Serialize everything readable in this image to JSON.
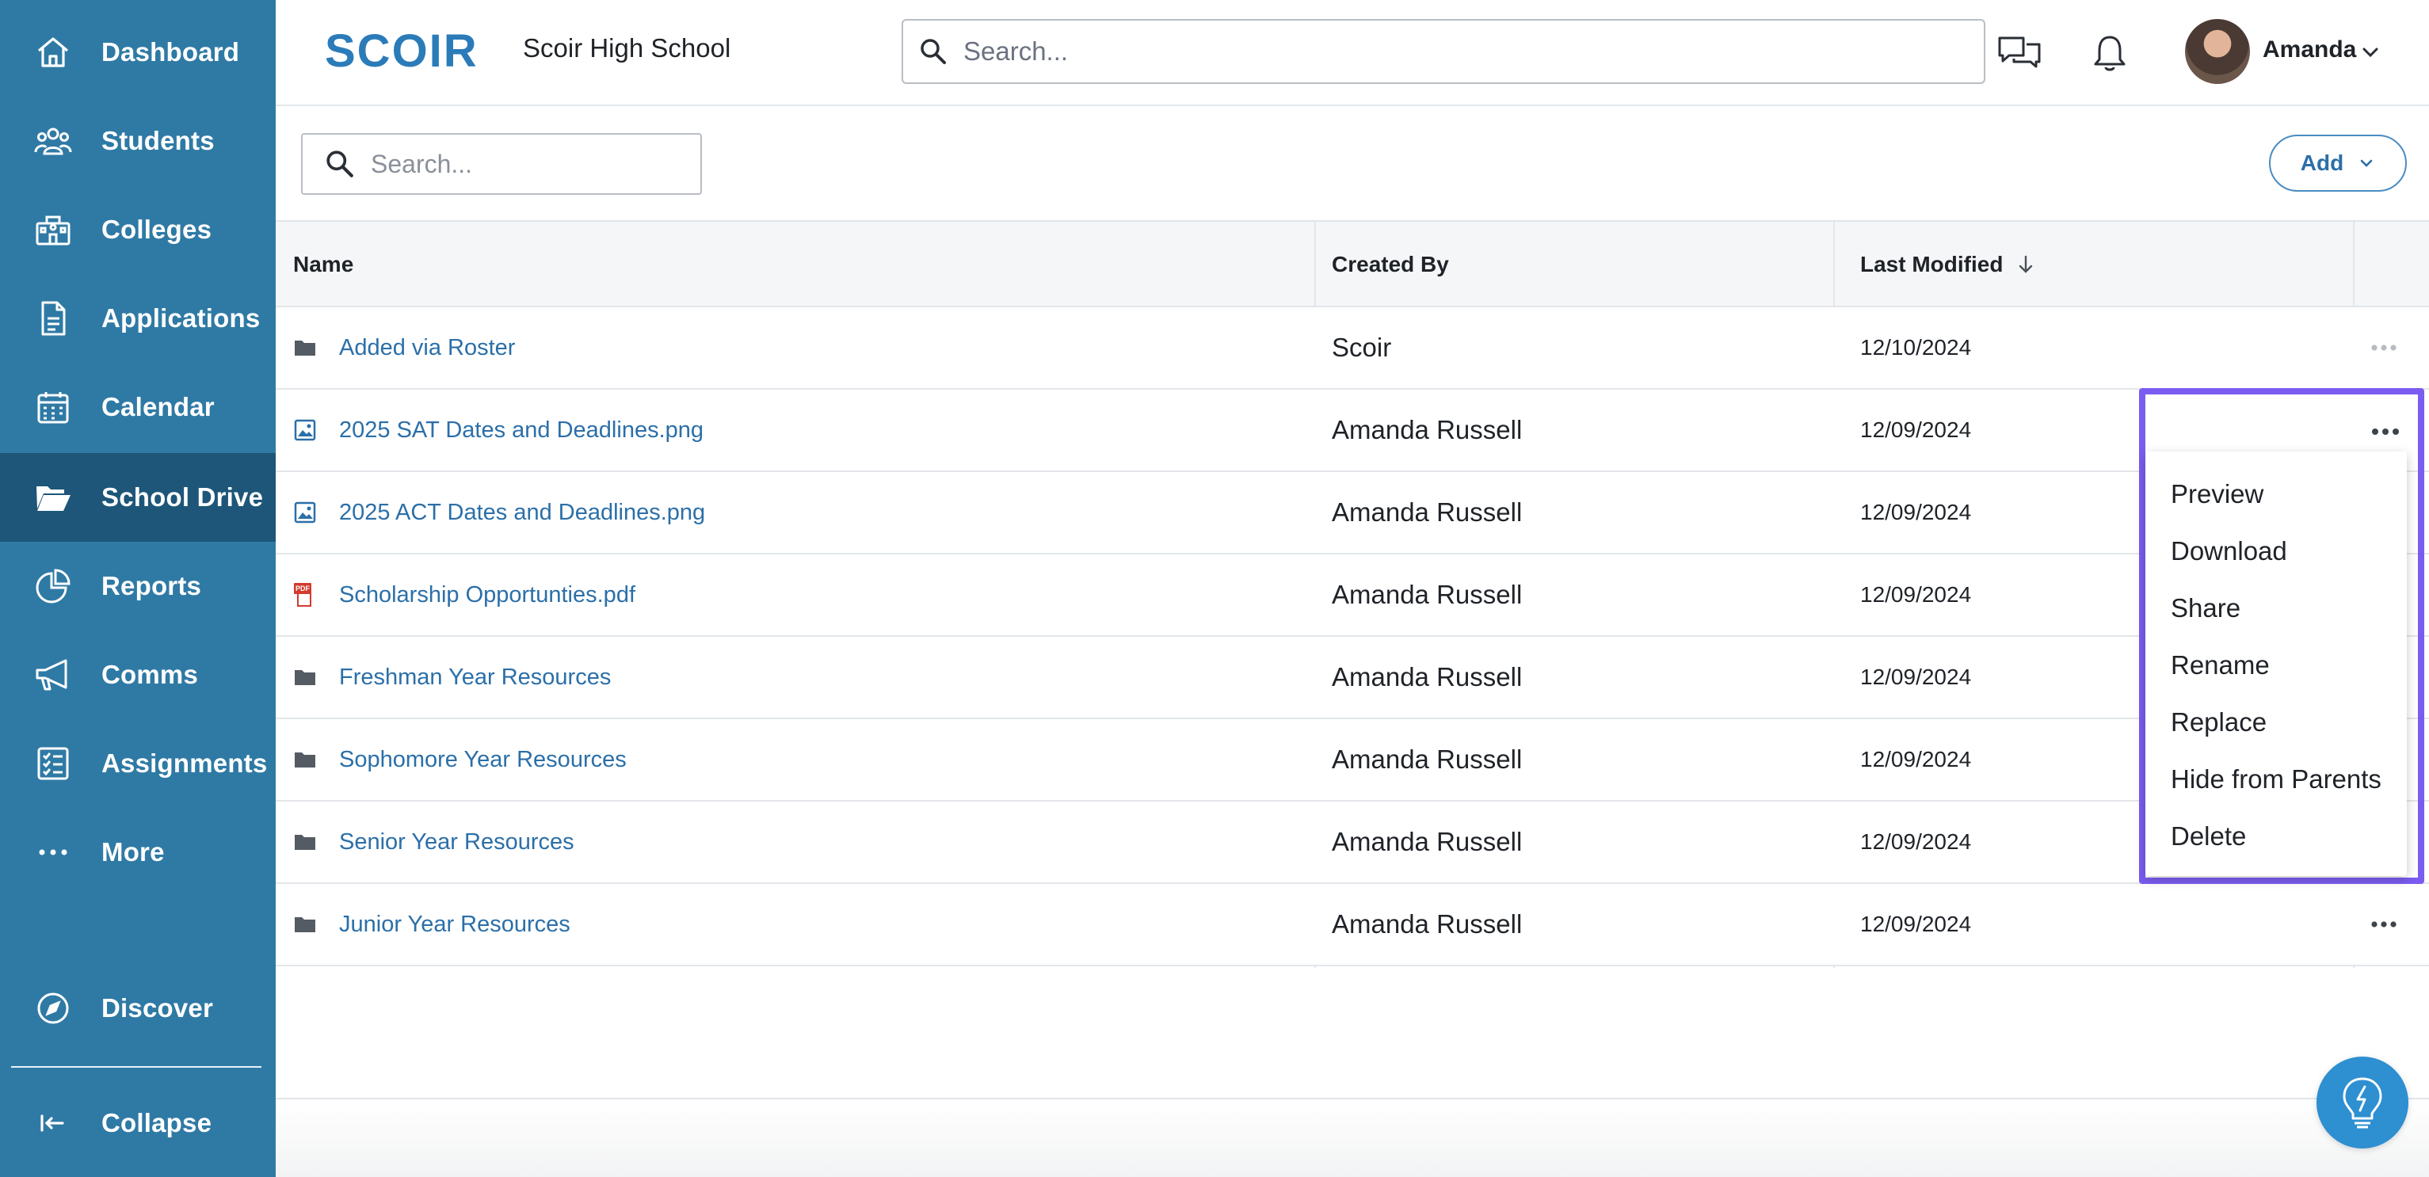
{
  "sidebar": {
    "items": [
      {
        "label": "Dashboard",
        "icon": "home-icon"
      },
      {
        "label": "Students",
        "icon": "users-icon"
      },
      {
        "label": "Colleges",
        "icon": "building-icon"
      },
      {
        "label": "Applications",
        "icon": "document-icon"
      },
      {
        "label": "Calendar",
        "icon": "calendar-icon"
      },
      {
        "label": "School Drive",
        "icon": "folder-open-icon",
        "active": true
      },
      {
        "label": "Reports",
        "icon": "pie-chart-icon"
      },
      {
        "label": "Comms",
        "icon": "megaphone-icon"
      },
      {
        "label": "Assignments",
        "icon": "checklist-icon"
      },
      {
        "label": "More",
        "icon": "ellipsis-icon"
      }
    ],
    "discover": {
      "label": "Discover",
      "icon": "compass-icon"
    },
    "collapse": {
      "label": "Collapse",
      "icon": "collapse-icon"
    }
  },
  "header": {
    "logo_text": "SCOIR",
    "school_name": "Scoir High School",
    "search_placeholder": "Search...",
    "user_name": "Amanda"
  },
  "toolbar": {
    "search_placeholder": "Search...",
    "add_label": "Add"
  },
  "table": {
    "columns": {
      "name": "Name",
      "created_by": "Created By",
      "last_modified": "Last Modified"
    },
    "rows": [
      {
        "name": "Added via Roster",
        "type": "folder",
        "created_by": "Scoir",
        "last_modified": "12/10/2024"
      },
      {
        "name": "2025 SAT Dates and Deadlines.png",
        "type": "image",
        "created_by": "Amanda Russell",
        "last_modified": "12/09/2024"
      },
      {
        "name": "2025 ACT Dates and Deadlines.png",
        "type": "image",
        "created_by": "Amanda Russell",
        "last_modified": "12/09/2024"
      },
      {
        "name": "Scholarship Opportunties.pdf",
        "type": "pdf",
        "created_by": "Amanda Russell",
        "last_modified": "12/09/2024"
      },
      {
        "name": "Freshman Year Resources",
        "type": "folder",
        "created_by": "Amanda Russell",
        "last_modified": "12/09/2024"
      },
      {
        "name": "Sophomore Year Resources",
        "type": "folder",
        "created_by": "Amanda Russell",
        "last_modified": "12/09/2024"
      },
      {
        "name": "Senior Year Resources",
        "type": "folder",
        "created_by": "Amanda Russell",
        "last_modified": "12/09/2024"
      },
      {
        "name": "Junior Year Resources",
        "type": "folder",
        "created_by": "Amanda Russell",
        "last_modified": "12/09/2024"
      }
    ]
  },
  "context_menu": {
    "items": [
      "Preview",
      "Download",
      "Share",
      "Rename",
      "Replace",
      "Hide from Parents",
      "Delete"
    ]
  },
  "colors": {
    "sidebar_bg": "#2f7aa5",
    "sidebar_active": "#1d5678",
    "link": "#2b6fa8",
    "highlight": "#7b5cf0"
  }
}
